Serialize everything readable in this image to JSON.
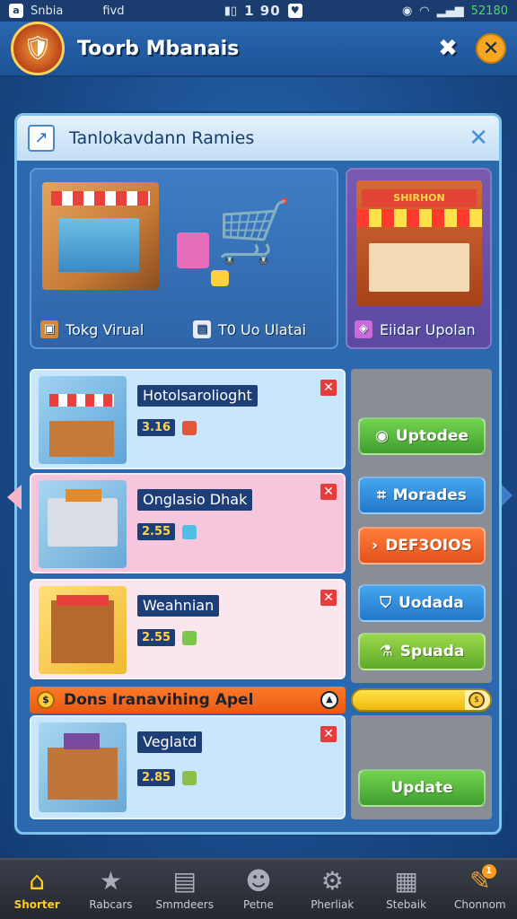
{
  "status_bar": {
    "app_label": "Snbia",
    "carrier": "fivd",
    "time": "1 90",
    "battery": "52180"
  },
  "header": {
    "title": "Toorb Mbanais"
  },
  "panel": {
    "title": "Tanlokavdann Ramies",
    "cards": [
      {
        "label": "Tokg Virual"
      },
      {
        "label": "T0 Uo Ulatai"
      },
      {
        "label": "Eiidar Upolan",
        "sign": "SHIRHON"
      }
    ],
    "list": [
      {
        "name": "Hotolsarolioght",
        "value": "3.16",
        "bg": "#c9e6fb"
      },
      {
        "name": "Onglasio Dhak",
        "value": "2.55",
        "bg": "#f6c7dc"
      },
      {
        "name": "Weahnian",
        "value": "2.55",
        "bg": "#fbe6ee"
      },
      {
        "name": "Veglatd",
        "value": "2.85",
        "bg": "#c9e6fb"
      }
    ],
    "actions": [
      {
        "label": "Uptodee",
        "style": "green"
      },
      {
        "label": "Morades",
        "style": "blue"
      },
      {
        "label": "DEF3OIOS",
        "style": "orange"
      },
      {
        "label": "Uodada",
        "style": "blue"
      },
      {
        "label": "Spuada",
        "style": "lime"
      }
    ],
    "banner": {
      "text": "Dons Iranavihing Apel"
    },
    "progress": 0.82,
    "update_button": "Update"
  },
  "nav": [
    {
      "label": "Shorter",
      "icon": "home-icon",
      "active": true
    },
    {
      "label": "Rabcars",
      "icon": "star-icon"
    },
    {
      "label": "Smmdeers",
      "icon": "book-icon"
    },
    {
      "label": "Petne",
      "icon": "chat-icon"
    },
    {
      "label": "Pherliak",
      "icon": "gear-icon"
    },
    {
      "label": "Stebaik",
      "icon": "grid-icon"
    },
    {
      "label": "Chonnom",
      "icon": "edit-icon",
      "badge": "1"
    }
  ]
}
